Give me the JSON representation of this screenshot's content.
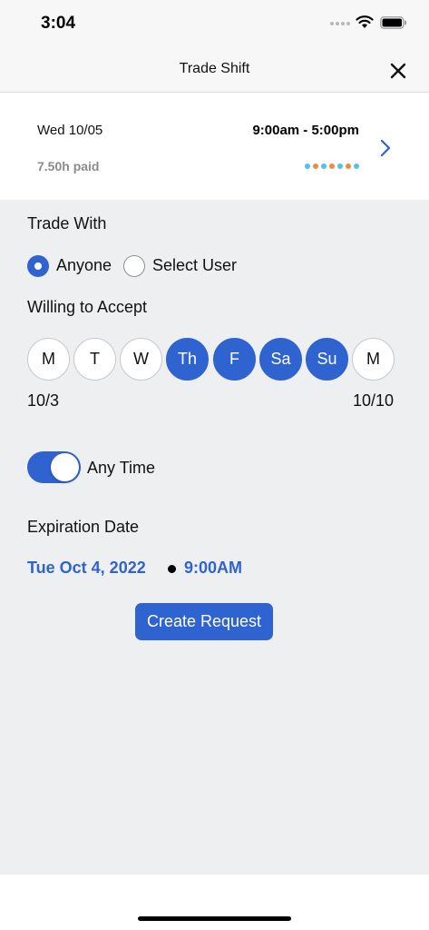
{
  "status_bar": {
    "time": "3:04"
  },
  "header": {
    "title": "Trade Shift"
  },
  "shift": {
    "date": "Wed 10/05",
    "time_range": "9:00am - 5:00pm",
    "paid_hours": "7.50h paid",
    "dot_colors": [
      "#4fc3e8",
      "#f08a3c",
      "#4fc3e8",
      "#f08a3c",
      "#4fc3e8",
      "#f08a3c",
      "#4fc3e8"
    ]
  },
  "trade_with": {
    "label": "Trade With",
    "options": [
      {
        "label": "Anyone",
        "selected": true
      },
      {
        "label": "Select User",
        "selected": false
      }
    ]
  },
  "willing": {
    "label": "Willing to Accept",
    "days": [
      {
        "label": "M",
        "selected": false
      },
      {
        "label": "T",
        "selected": false
      },
      {
        "label": "W",
        "selected": false
      },
      {
        "label": "Th",
        "selected": true
      },
      {
        "label": "F",
        "selected": true
      },
      {
        "label": "Sa",
        "selected": true
      },
      {
        "label": "Su",
        "selected": true
      },
      {
        "label": "M",
        "selected": false
      }
    ],
    "start_date": "10/3",
    "end_date": "10/10"
  },
  "any_time": {
    "label": "Any Time",
    "on": true
  },
  "expiration": {
    "label": "Expiration Date",
    "date": "Tue Oct 4, 2022",
    "time": "9:00AM"
  },
  "create_button": {
    "label": "Create Request"
  },
  "colors": {
    "accent": "#2f63d0",
    "background": "#eeeff1"
  }
}
